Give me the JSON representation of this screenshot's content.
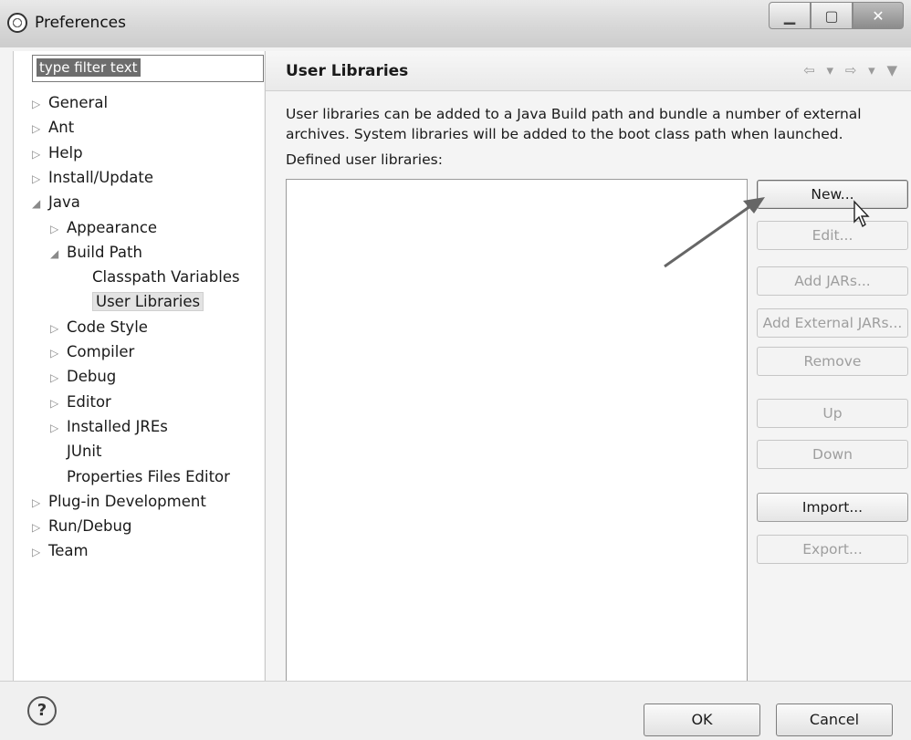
{
  "window": {
    "title": "Preferences",
    "icon": "eclipse-icon",
    "controls": [
      "minimize",
      "maximize",
      "close"
    ]
  },
  "filter": {
    "value": "type filter text"
  },
  "tree": [
    {
      "label": "General",
      "expander": "▷",
      "level": 0
    },
    {
      "label": "Ant",
      "expander": "▷",
      "level": 0
    },
    {
      "label": "Help",
      "expander": "▷",
      "level": 0
    },
    {
      "label": "Install/Update",
      "expander": "▷",
      "level": 0
    },
    {
      "label": "Java",
      "expander": "◢",
      "level": 0
    },
    {
      "label": "Appearance",
      "expander": "▷",
      "level": 1
    },
    {
      "label": "Build Path",
      "expander": "◢",
      "level": 1
    },
    {
      "label": "Classpath Variables",
      "expander": "",
      "level": 2
    },
    {
      "label": "User Libraries",
      "expander": "",
      "level": 2,
      "selected": true
    },
    {
      "label": "Code Style",
      "expander": "▷",
      "level": 1
    },
    {
      "label": "Compiler",
      "expander": "▷",
      "level": 1
    },
    {
      "label": "Debug",
      "expander": "▷",
      "level": 1
    },
    {
      "label": "Editor",
      "expander": "▷",
      "level": 1
    },
    {
      "label": "Installed JREs",
      "expander": "▷",
      "level": 1
    },
    {
      "label": "JUnit",
      "expander": "",
      "level": 1
    },
    {
      "label": "Properties Files Editor",
      "expander": "",
      "level": 1
    },
    {
      "label": "Plug-in Development",
      "expander": "▷",
      "level": 0
    },
    {
      "label": "Run/Debug",
      "expander": "▷",
      "level": 0
    },
    {
      "label": "Team",
      "expander": "▷",
      "level": 0
    }
  ],
  "page": {
    "title": "User Libraries",
    "nav": "⇦ ▾ ⇨ ▾ ▼",
    "description": "User libraries can be added to a Java Build path and bundle a number of external archives. System libraries will be added to the boot class path when launched.",
    "defined_label": "Defined user libraries:"
  },
  "buttons": {
    "new": "New...",
    "edit": "Edit...",
    "add_jars": "Add JARs...",
    "add_external_jars": "Add External JARs...",
    "remove": "Remove",
    "up": "Up",
    "down": "Down",
    "import": "Import...",
    "export": "Export..."
  },
  "footer": {
    "help": "?",
    "ok": "OK",
    "cancel": "Cancel"
  }
}
